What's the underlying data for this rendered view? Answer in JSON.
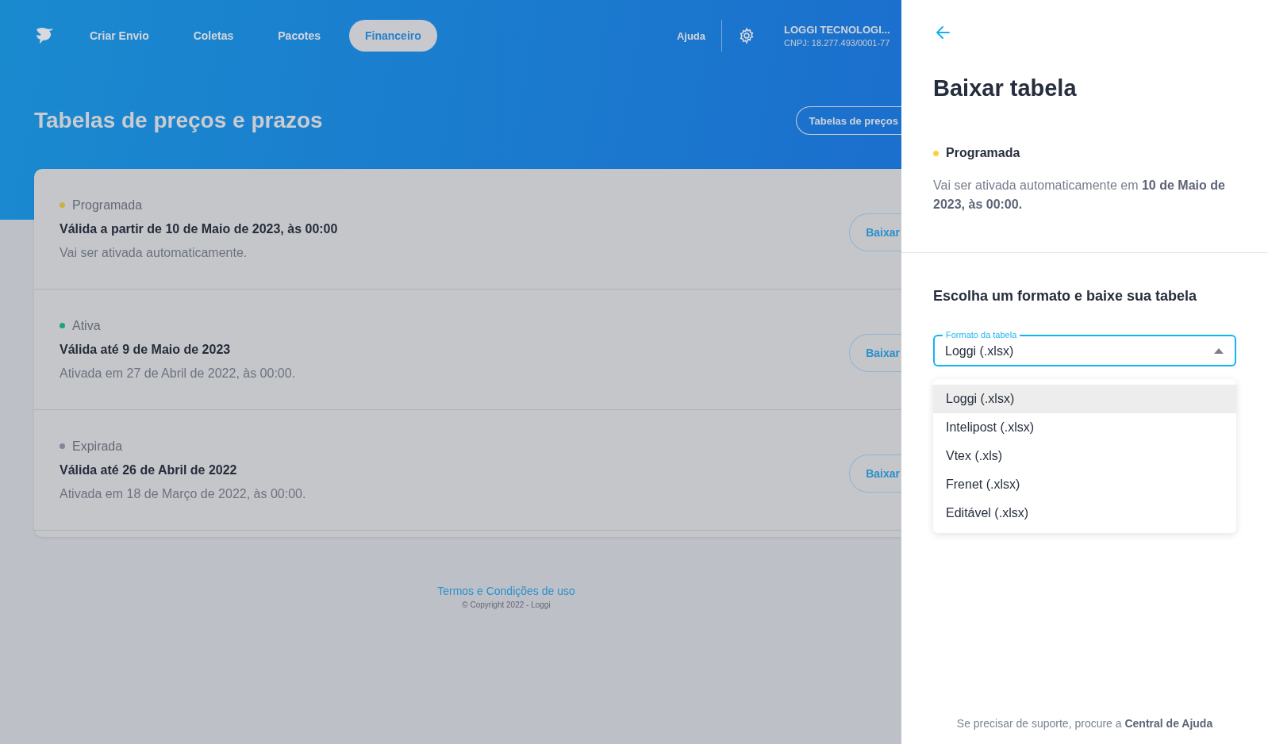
{
  "nav": {
    "items": [
      {
        "label": "Criar Envio",
        "selected": false
      },
      {
        "label": "Coletas",
        "selected": false
      },
      {
        "label": "Pacotes",
        "selected": false
      },
      {
        "label": "Financeiro",
        "selected": true
      }
    ],
    "help": "Ajuda",
    "company": "LOGGI TECNOLOGI...",
    "cnpj": "CNPJ: 18.277.493/0001-77"
  },
  "page": {
    "title": "Tabelas de preços e prazos",
    "header_button": "Tabelas de preços"
  },
  "tables": [
    {
      "status": "Programada",
      "color": "#cdae48",
      "validity": "Válida a partir de 10 de Maio de 2023, às 00:00",
      "note": "Vai ser ativada automaticamente.",
      "button": "Baixar"
    },
    {
      "status": "Ativa",
      "color": "#1aa67a",
      "validity": "Válida até 9 de Maio de 2023",
      "note": "Ativada em 27 de Abril de 2022, às 00:00.",
      "button": "Baixar"
    },
    {
      "status": "Expirada",
      "color": "#7d8798",
      "validity": "Válida até 26 de Abril de 2022",
      "note": "Ativada em 18 de Março de 2022, às 00:00.",
      "button": "Baixar"
    }
  ],
  "footer": {
    "link": "Termos e Condições de uso",
    "copyright": "© Copyright 2022 - Loggi"
  },
  "drawer": {
    "title": "Baixar tabela",
    "status": "Programada",
    "description": "Vai ser ativada automaticamente em **10 de Maio de 2023, às 00:00.**",
    "heading": "Escolha um formato e baixe sua tabela",
    "field": {
      "label": "Formato da tabela",
      "value": "Loggi (.xlsx)"
    },
    "options": [
      {
        "label": "Loggi (.xlsx)",
        "selected": true
      },
      {
        "label": "Intelipost (.xlsx)",
        "selected": false
      },
      {
        "label": "Vtex (.xls)",
        "selected": false
      },
      {
        "label": "Frenet (.xlsx)",
        "selected": false
      },
      {
        "label": "Editável (.xlsx)",
        "selected": false
      }
    ],
    "support": "Se precisar de suporte, procure a **Central de Ajuda**"
  }
}
